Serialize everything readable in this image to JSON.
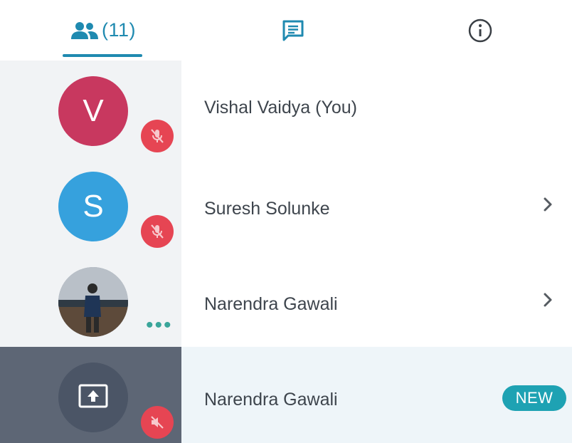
{
  "tabs": {
    "people_count": "(11)"
  },
  "participants": [
    {
      "name": "Vishal Vaidya (You)",
      "initial": "V"
    },
    {
      "name": "Suresh Solunke",
      "initial": "S"
    },
    {
      "name": "Narendra Gawali"
    },
    {
      "name": "Narendra Gawali",
      "badge": "NEW"
    }
  ]
}
